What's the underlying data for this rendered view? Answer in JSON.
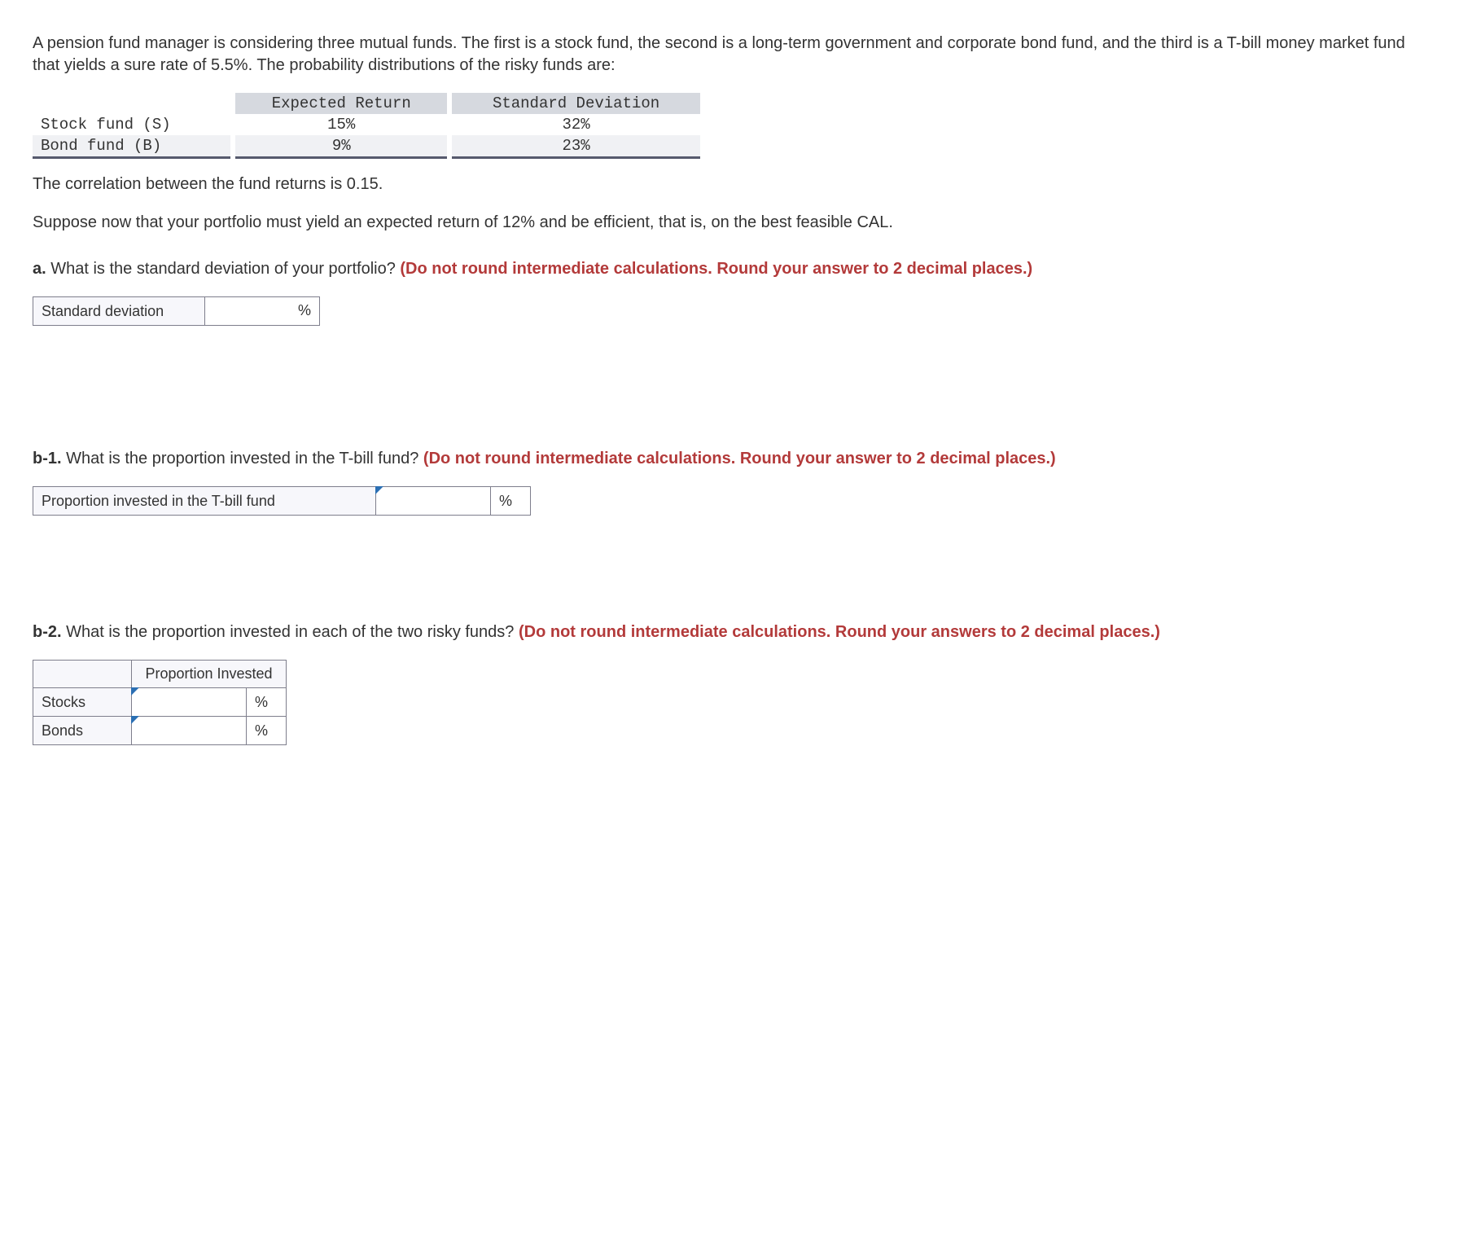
{
  "intro": "A pension fund manager is considering three mutual funds. The first is a stock fund, the second is a long-term government and corporate bond fund, and the third is a T-bill money market fund that yields a sure rate of 5.5%. The probability distributions of the risky funds are:",
  "data_table": {
    "headers": [
      "",
      "Expected Return",
      "Standard Deviation"
    ],
    "rows": [
      {
        "label": "Stock fund (S)",
        "er": "15%",
        "sd": "32%"
      },
      {
        "label": "Bond fund (B)",
        "er": "9%",
        "sd": "23%"
      }
    ]
  },
  "correlation_text": "The correlation between the fund returns is 0.15.",
  "suppose_text": "Suppose now that your portfolio must yield an expected return of 12% and be efficient, that is, on the best feasible CAL.",
  "qa": {
    "label": "a.",
    "text": "What is the standard deviation of your portfolio? ",
    "hint": "(Do not round intermediate calculations. Round your answer to 2 decimal places.)",
    "row_label": "Standard deviation",
    "unit": "%"
  },
  "qb1": {
    "label": "b-1.",
    "text": "What is the proportion invested in the T-bill fund? ",
    "hint": "(Do not round intermediate calculations. Round your answer to 2 decimal places.)",
    "row_label": "Proportion invested in the T-bill fund",
    "unit": "%"
  },
  "qb2": {
    "label": "b-2.",
    "text": "What is the proportion invested in each of the two risky funds? ",
    "hint": "(Do not round intermediate calculations. Round your answers to 2 decimal places.)",
    "header": "Proportion Invested",
    "rows": [
      {
        "label": "Stocks",
        "unit": "%"
      },
      {
        "label": "Bonds",
        "unit": "%"
      }
    ]
  }
}
